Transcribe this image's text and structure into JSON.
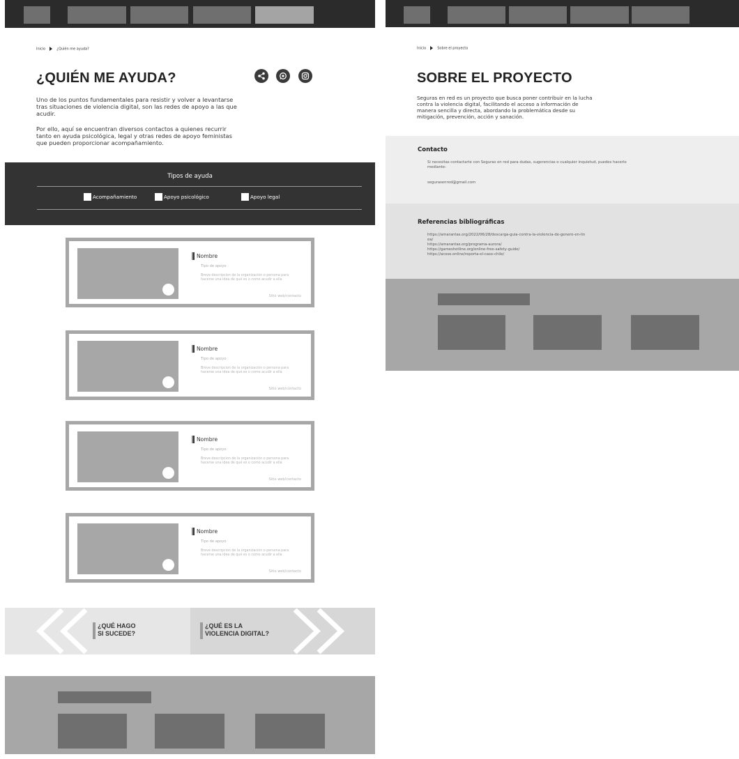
{
  "left_page": {
    "breadcrumb": {
      "home": "Inicio",
      "current": "¿Quién me ayuda?"
    },
    "title": "¿QUIÉN ME AYUDA?",
    "intro_p1": "Uno de los puntos fundamentales para resistir y volver a levantarse tras situaciones de violencia digital, son las redes de apoyo a las que acudir.",
    "intro_p2": "Por ello, aquí se encuentran diversos contactos a quienes recurrir tanto en ayuda psicológica, legal y otras redes de apoyo feministas que pueden proporcionar acompañamiento.",
    "social_icons": [
      "share-icon",
      "whatsapp-icon",
      "instagram-icon"
    ],
    "filter": {
      "title": "Tipos de ayuda",
      "options": [
        "Acompañamiento",
        "Apoyo psicológico",
        "Apoyo legal"
      ]
    },
    "cards": [
      {
        "name": "Nombre",
        "type": "Tipo de apoyo",
        "description": "Breve descripcion de la organización o persona para hacerse una idea de qué es o como acudir a ella",
        "link": "Sitio web/contacto"
      },
      {
        "name": "Nombre",
        "type": "Tipo de apoyo",
        "description": "Breve descripcion de la organización o persona para hacerse una idea de qué es o como acudir a ella",
        "link": "Sitio web/contacto"
      },
      {
        "name": "Nombre",
        "type": "Tipo de apoyo",
        "description": "Breve descripcion de la organización o persona para hacerse una idea de qué es o como acudir a ella",
        "link": "Sitio web/contacto"
      },
      {
        "name": "Nombre",
        "type": "Tipo de apoyo",
        "description": "Breve descripcion de la organización o persona para hacerse una idea de qué es o como acudir a ella",
        "link": "Sitio web/contacto"
      }
    ],
    "bottom_nav": {
      "prev_line1": "¿QUÉ HAGO",
      "prev_line2": "SI SUCEDE?",
      "next_line1": "¿QUÉ ES LA",
      "next_line2": "VIOLENCIA DIGITAL?"
    }
  },
  "right_page": {
    "breadcrumb": {
      "home": "Inicio",
      "current": "Sobre el proyecto"
    },
    "title": "SOBRE EL PROYECTO",
    "intro": "Seguras en red es un proyecto que busca poner contribuir en la lucha contra la violencia digital, facilitando el acceso a información de manera sencilla y directa, abordando la problemática desde su mitigación, prevención, acción y sanación.",
    "contact": {
      "title": "Contacto",
      "text": "Si necesitas contactarte con Seguras en red para dudas, sugerencias o cualquier inquietud, puedes hacerlo mediante:",
      "email": "segurasenred@gmail.com"
    },
    "references": {
      "title": "Referencias bibliográficas",
      "links": [
        "https://amarantas.org/2022/06/28/descarga-guia-contra-la-violencia-de-genero-en-lin",
        "ea/",
        "https://amarantas.org/programa-aurora/",
        "https://gameshotline.org/online-free-safety-guide/",
        "https://acoso.online/reporta-el-caso-chile/"
      ]
    }
  },
  "colors": {
    "dark": "#2b2b2b",
    "nav_block": "#6f6f6f",
    "nav_active": "#a4a4a4",
    "placeholder": "#a7a7a7"
  }
}
